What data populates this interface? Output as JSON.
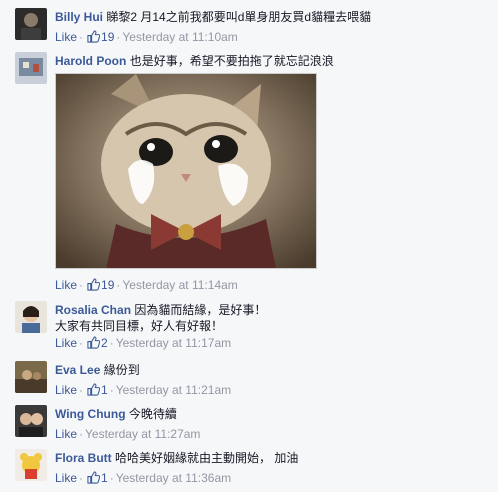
{
  "comments": [
    {
      "name": "Billy Hui",
      "text": "睇黎2 月14之前我都要叫d單身朋友買d貓糧去喂貓",
      "like": "Like",
      "count": "19",
      "time": "Yesterday at 11:10am"
    },
    {
      "name": "Harold Poon",
      "text": "也是好事，希望不要拍拖了就忘記浪浪",
      "like": "Like",
      "count": "19",
      "time": "Yesterday at 11:14am"
    },
    {
      "name": "Rosalia Chan",
      "text": "因為貓而結緣，是好事！",
      "text2": "大家有共同目標，好人有好報！",
      "like": "Like",
      "count": "2",
      "time": "Yesterday at 11:17am"
    },
    {
      "name": "Eva Lee",
      "text": "緣份到",
      "like": "Like",
      "count": "1",
      "time": "Yesterday at 11:21am"
    },
    {
      "name": "Wing Chung",
      "text": "今晚待續",
      "like": "Like",
      "count": "",
      "time": "Yesterday at 11:27am"
    },
    {
      "name": "Flora Butt",
      "text": "哈哈美好姻緣就由主動開始， 加油",
      "like": "Like",
      "count": "1",
      "time": "Yesterday at 11:36am"
    }
  ],
  "separator": "·",
  "icons": {
    "like": "thumbs-up-icon"
  },
  "colors": {
    "name": "#3b5998",
    "meta": "#9197a3",
    "background": "#f6f7f9"
  }
}
